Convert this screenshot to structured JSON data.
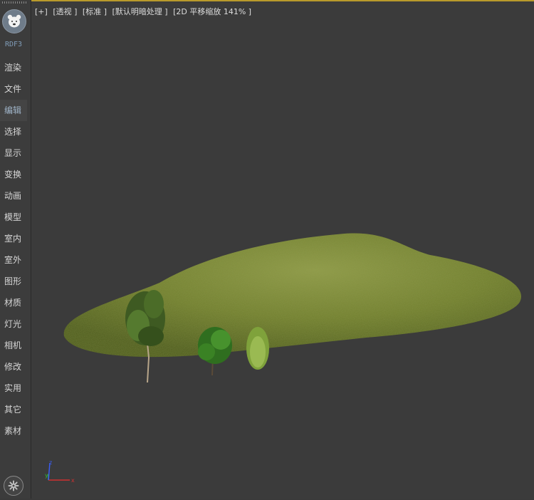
{
  "sidebar": {
    "brand": "RDF3",
    "items": [
      {
        "label": "渲染"
      },
      {
        "label": "文件"
      },
      {
        "label": "编辑",
        "active": true
      },
      {
        "label": "选择"
      },
      {
        "label": "显示"
      },
      {
        "label": "变换"
      },
      {
        "label": "动画"
      },
      {
        "label": "模型"
      },
      {
        "label": "室内"
      },
      {
        "label": "室外"
      },
      {
        "label": "图形"
      },
      {
        "label": "材质"
      },
      {
        "label": "灯光"
      },
      {
        "label": "相机"
      },
      {
        "label": "修改"
      },
      {
        "label": "实用"
      },
      {
        "label": "其它"
      },
      {
        "label": "素材"
      }
    ]
  },
  "viewport": {
    "labels": [
      "[+]",
      "[透视 ]",
      "[标准 ]",
      "[默认明暗处理 ]",
      "[2D 平移缩放 141% ]"
    ],
    "axis": {
      "x": "x",
      "y": "y",
      "z": "z"
    }
  },
  "colors": {
    "accent_border": "#b99a2b",
    "terrain": "#7c8a34",
    "axis_x": "#d03030",
    "axis_y": "#30c030",
    "axis_z": "#3a5cf0"
  }
}
